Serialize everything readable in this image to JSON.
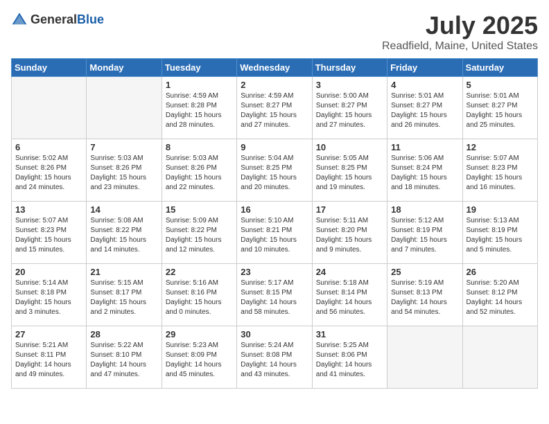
{
  "header": {
    "logo": {
      "text_general": "General",
      "text_blue": "Blue"
    },
    "title": "July 2025",
    "location": "Readfield, Maine, United States"
  },
  "weekdays": [
    "Sunday",
    "Monday",
    "Tuesday",
    "Wednesday",
    "Thursday",
    "Friday",
    "Saturday"
  ],
  "weeks": [
    [
      {
        "day": "",
        "empty": true
      },
      {
        "day": "",
        "empty": true
      },
      {
        "day": "1",
        "sunrise": "Sunrise: 4:59 AM",
        "sunset": "Sunset: 8:28 PM",
        "daylight": "Daylight: 15 hours and 28 minutes."
      },
      {
        "day": "2",
        "sunrise": "Sunrise: 4:59 AM",
        "sunset": "Sunset: 8:27 PM",
        "daylight": "Daylight: 15 hours and 27 minutes."
      },
      {
        "day": "3",
        "sunrise": "Sunrise: 5:00 AM",
        "sunset": "Sunset: 8:27 PM",
        "daylight": "Daylight: 15 hours and 27 minutes."
      },
      {
        "day": "4",
        "sunrise": "Sunrise: 5:01 AM",
        "sunset": "Sunset: 8:27 PM",
        "daylight": "Daylight: 15 hours and 26 minutes."
      },
      {
        "day": "5",
        "sunrise": "Sunrise: 5:01 AM",
        "sunset": "Sunset: 8:27 PM",
        "daylight": "Daylight: 15 hours and 25 minutes."
      }
    ],
    [
      {
        "day": "6",
        "sunrise": "Sunrise: 5:02 AM",
        "sunset": "Sunset: 8:26 PM",
        "daylight": "Daylight: 15 hours and 24 minutes."
      },
      {
        "day": "7",
        "sunrise": "Sunrise: 5:03 AM",
        "sunset": "Sunset: 8:26 PM",
        "daylight": "Daylight: 15 hours and 23 minutes."
      },
      {
        "day": "8",
        "sunrise": "Sunrise: 5:03 AM",
        "sunset": "Sunset: 8:26 PM",
        "daylight": "Daylight: 15 hours and 22 minutes."
      },
      {
        "day": "9",
        "sunrise": "Sunrise: 5:04 AM",
        "sunset": "Sunset: 8:25 PM",
        "daylight": "Daylight: 15 hours and 20 minutes."
      },
      {
        "day": "10",
        "sunrise": "Sunrise: 5:05 AM",
        "sunset": "Sunset: 8:25 PM",
        "daylight": "Daylight: 15 hours and 19 minutes."
      },
      {
        "day": "11",
        "sunrise": "Sunrise: 5:06 AM",
        "sunset": "Sunset: 8:24 PM",
        "daylight": "Daylight: 15 hours and 18 minutes."
      },
      {
        "day": "12",
        "sunrise": "Sunrise: 5:07 AM",
        "sunset": "Sunset: 8:23 PM",
        "daylight": "Daylight: 15 hours and 16 minutes."
      }
    ],
    [
      {
        "day": "13",
        "sunrise": "Sunrise: 5:07 AM",
        "sunset": "Sunset: 8:23 PM",
        "daylight": "Daylight: 15 hours and 15 minutes."
      },
      {
        "day": "14",
        "sunrise": "Sunrise: 5:08 AM",
        "sunset": "Sunset: 8:22 PM",
        "daylight": "Daylight: 15 hours and 14 minutes."
      },
      {
        "day": "15",
        "sunrise": "Sunrise: 5:09 AM",
        "sunset": "Sunset: 8:22 PM",
        "daylight": "Daylight: 15 hours and 12 minutes."
      },
      {
        "day": "16",
        "sunrise": "Sunrise: 5:10 AM",
        "sunset": "Sunset: 8:21 PM",
        "daylight": "Daylight: 15 hours and 10 minutes."
      },
      {
        "day": "17",
        "sunrise": "Sunrise: 5:11 AM",
        "sunset": "Sunset: 8:20 PM",
        "daylight": "Daylight: 15 hours and 9 minutes."
      },
      {
        "day": "18",
        "sunrise": "Sunrise: 5:12 AM",
        "sunset": "Sunset: 8:19 PM",
        "daylight": "Daylight: 15 hours and 7 minutes."
      },
      {
        "day": "19",
        "sunrise": "Sunrise: 5:13 AM",
        "sunset": "Sunset: 8:19 PM",
        "daylight": "Daylight: 15 hours and 5 minutes."
      }
    ],
    [
      {
        "day": "20",
        "sunrise": "Sunrise: 5:14 AM",
        "sunset": "Sunset: 8:18 PM",
        "daylight": "Daylight: 15 hours and 3 minutes."
      },
      {
        "day": "21",
        "sunrise": "Sunrise: 5:15 AM",
        "sunset": "Sunset: 8:17 PM",
        "daylight": "Daylight: 15 hours and 2 minutes."
      },
      {
        "day": "22",
        "sunrise": "Sunrise: 5:16 AM",
        "sunset": "Sunset: 8:16 PM",
        "daylight": "Daylight: 15 hours and 0 minutes."
      },
      {
        "day": "23",
        "sunrise": "Sunrise: 5:17 AM",
        "sunset": "Sunset: 8:15 PM",
        "daylight": "Daylight: 14 hours and 58 minutes."
      },
      {
        "day": "24",
        "sunrise": "Sunrise: 5:18 AM",
        "sunset": "Sunset: 8:14 PM",
        "daylight": "Daylight: 14 hours and 56 minutes."
      },
      {
        "day": "25",
        "sunrise": "Sunrise: 5:19 AM",
        "sunset": "Sunset: 8:13 PM",
        "daylight": "Daylight: 14 hours and 54 minutes."
      },
      {
        "day": "26",
        "sunrise": "Sunrise: 5:20 AM",
        "sunset": "Sunset: 8:12 PM",
        "daylight": "Daylight: 14 hours and 52 minutes."
      }
    ],
    [
      {
        "day": "27",
        "sunrise": "Sunrise: 5:21 AM",
        "sunset": "Sunset: 8:11 PM",
        "daylight": "Daylight: 14 hours and 49 minutes."
      },
      {
        "day": "28",
        "sunrise": "Sunrise: 5:22 AM",
        "sunset": "Sunset: 8:10 PM",
        "daylight": "Daylight: 14 hours and 47 minutes."
      },
      {
        "day": "29",
        "sunrise": "Sunrise: 5:23 AM",
        "sunset": "Sunset: 8:09 PM",
        "daylight": "Daylight: 14 hours and 45 minutes."
      },
      {
        "day": "30",
        "sunrise": "Sunrise: 5:24 AM",
        "sunset": "Sunset: 8:08 PM",
        "daylight": "Daylight: 14 hours and 43 minutes."
      },
      {
        "day": "31",
        "sunrise": "Sunrise: 5:25 AM",
        "sunset": "Sunset: 8:06 PM",
        "daylight": "Daylight: 14 hours and 41 minutes."
      },
      {
        "day": "",
        "empty": true
      },
      {
        "day": "",
        "empty": true
      }
    ]
  ]
}
